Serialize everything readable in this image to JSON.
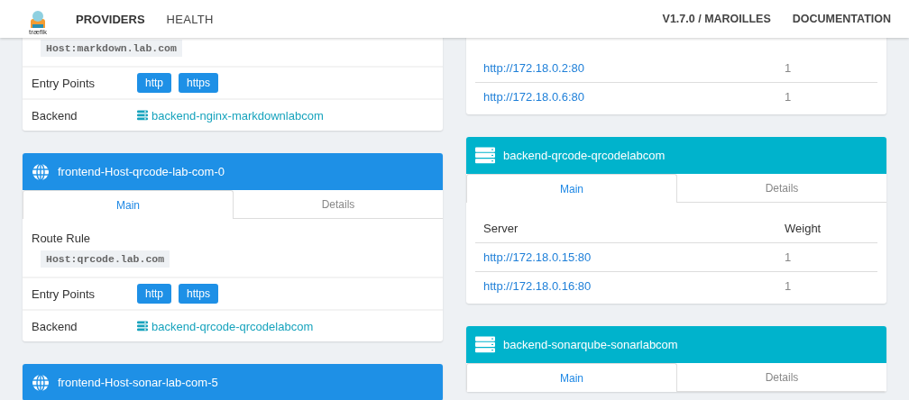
{
  "header": {
    "logo_text": "træfik",
    "nav": [
      {
        "label": "PROVIDERS"
      },
      {
        "label": "HEALTH"
      }
    ],
    "version": "V1.7.0 / MAROILLES",
    "documentation": "DOCUMENTATION"
  },
  "frontends": [
    {
      "route_rule": "Host:markdown.lab.com",
      "entry_points_label": "Entry Points",
      "entry_points": [
        "http",
        "https"
      ],
      "backend_label": "Backend",
      "backend": "backend-nginx-markdownlabcom"
    },
    {
      "title": "frontend-Host-qrcode-lab-com-0",
      "tabs": [
        {
          "label": "Main",
          "selected": true
        },
        {
          "label": "Details",
          "selected": false
        }
      ],
      "route_rule_label": "Route Rule",
      "route_rule": "Host:qrcode.lab.com",
      "entry_points_label": "Entry Points",
      "entry_points": [
        "http",
        "https"
      ],
      "backend_label": "Backend",
      "backend": "backend-qrcode-qrcodelabcom"
    },
    {
      "title": "frontend-Host-sonar-lab-com-5"
    }
  ],
  "backends": [
    {
      "servers": [
        {
          "url": "http://172.18.0.2:80",
          "weight": "1"
        },
        {
          "url": "http://172.18.0.6:80",
          "weight": "1"
        }
      ]
    },
    {
      "title": "backend-qrcode-qrcodelabcom",
      "tabs": [
        {
          "label": "Main",
          "selected": true
        },
        {
          "label": "Details",
          "selected": false
        }
      ],
      "columns": [
        "Server",
        "Weight"
      ],
      "servers": [
        {
          "url": "http://172.18.0.15:80",
          "weight": "1"
        },
        {
          "url": "http://172.18.0.16:80",
          "weight": "1"
        }
      ]
    },
    {
      "title": "backend-sonarqube-sonarlabcom",
      "tabs": [
        {
          "label": "Main",
          "selected": true
        },
        {
          "label": "Details",
          "selected": false
        }
      ]
    }
  ]
}
